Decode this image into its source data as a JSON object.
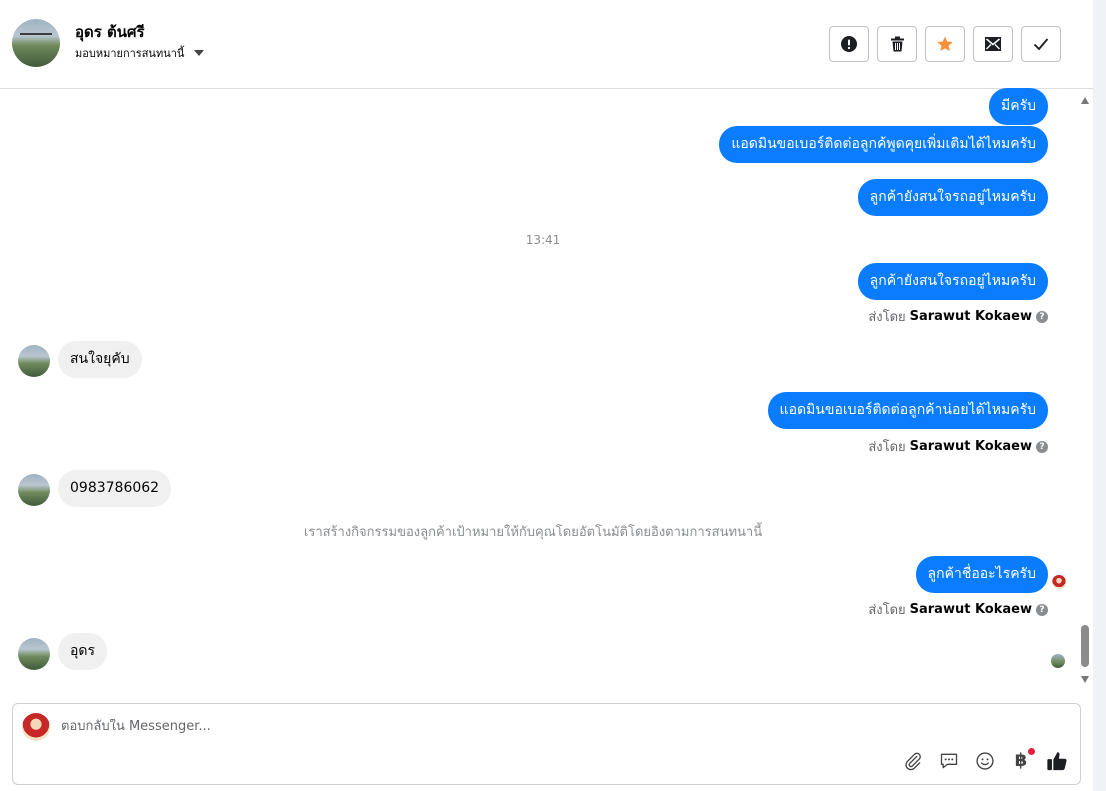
{
  "header": {
    "contact_name": "อุดร ต้นศรี",
    "assign_label": "มอบหมายการสนทนานี้",
    "actions": [
      {
        "name": "spam",
        "icon": "exclamation-circle-icon"
      },
      {
        "name": "delete",
        "icon": "trash-icon"
      },
      {
        "name": "star",
        "icon": "star-icon",
        "color": "#f7923a"
      },
      {
        "name": "mark-unread",
        "icon": "envelope-icon"
      },
      {
        "name": "done",
        "icon": "check-icon"
      }
    ]
  },
  "messages": {
    "m1": "มีครับ",
    "m2": "แอดมินขอเบอร์ติดต่อลูกค้พูดคุยเพิ่มเติมได้ไหมครับ",
    "m3": "ลูกค้ายังสนใจรถอยู่ไหมครับ",
    "time1": "13:41",
    "m4": "ลูกค้ายังสนใจรถอยู่ไหมครับ",
    "m5_in": "สนใจยุคับ",
    "m6": "แอดมินขอเบอร์ติดต่อลูกค้าน่อยได้ไหมครับ",
    "m7_in": "0983786062",
    "system_note": "เราสร้างกิจกรรมของลูกค้าเป้าหมายให้กับคุณโดยอัตโนมัติโดยอิงตามการสนทนานี้",
    "m8": "ลูกค้าชื่ออะไรครับ",
    "m9_in": "อุดร"
  },
  "sent_by": {
    "prefix": "ส่งโดย",
    "name": "Sarawut Kokaew",
    "help": "?"
  },
  "composer": {
    "placeholder": "ตอบกลับใน Messenger...",
    "tools": [
      "paperclip-icon",
      "chat-bubble-icon",
      "smiley-icon",
      "baht-icon",
      "thumbs-up-icon"
    ],
    "baht_symbol": "฿"
  },
  "colors": {
    "outgoing_bubble": "#0a7cff",
    "incoming_bubble": "#f0f0f0",
    "star": "#f7923a",
    "notification_dot": "#e41e3f"
  }
}
